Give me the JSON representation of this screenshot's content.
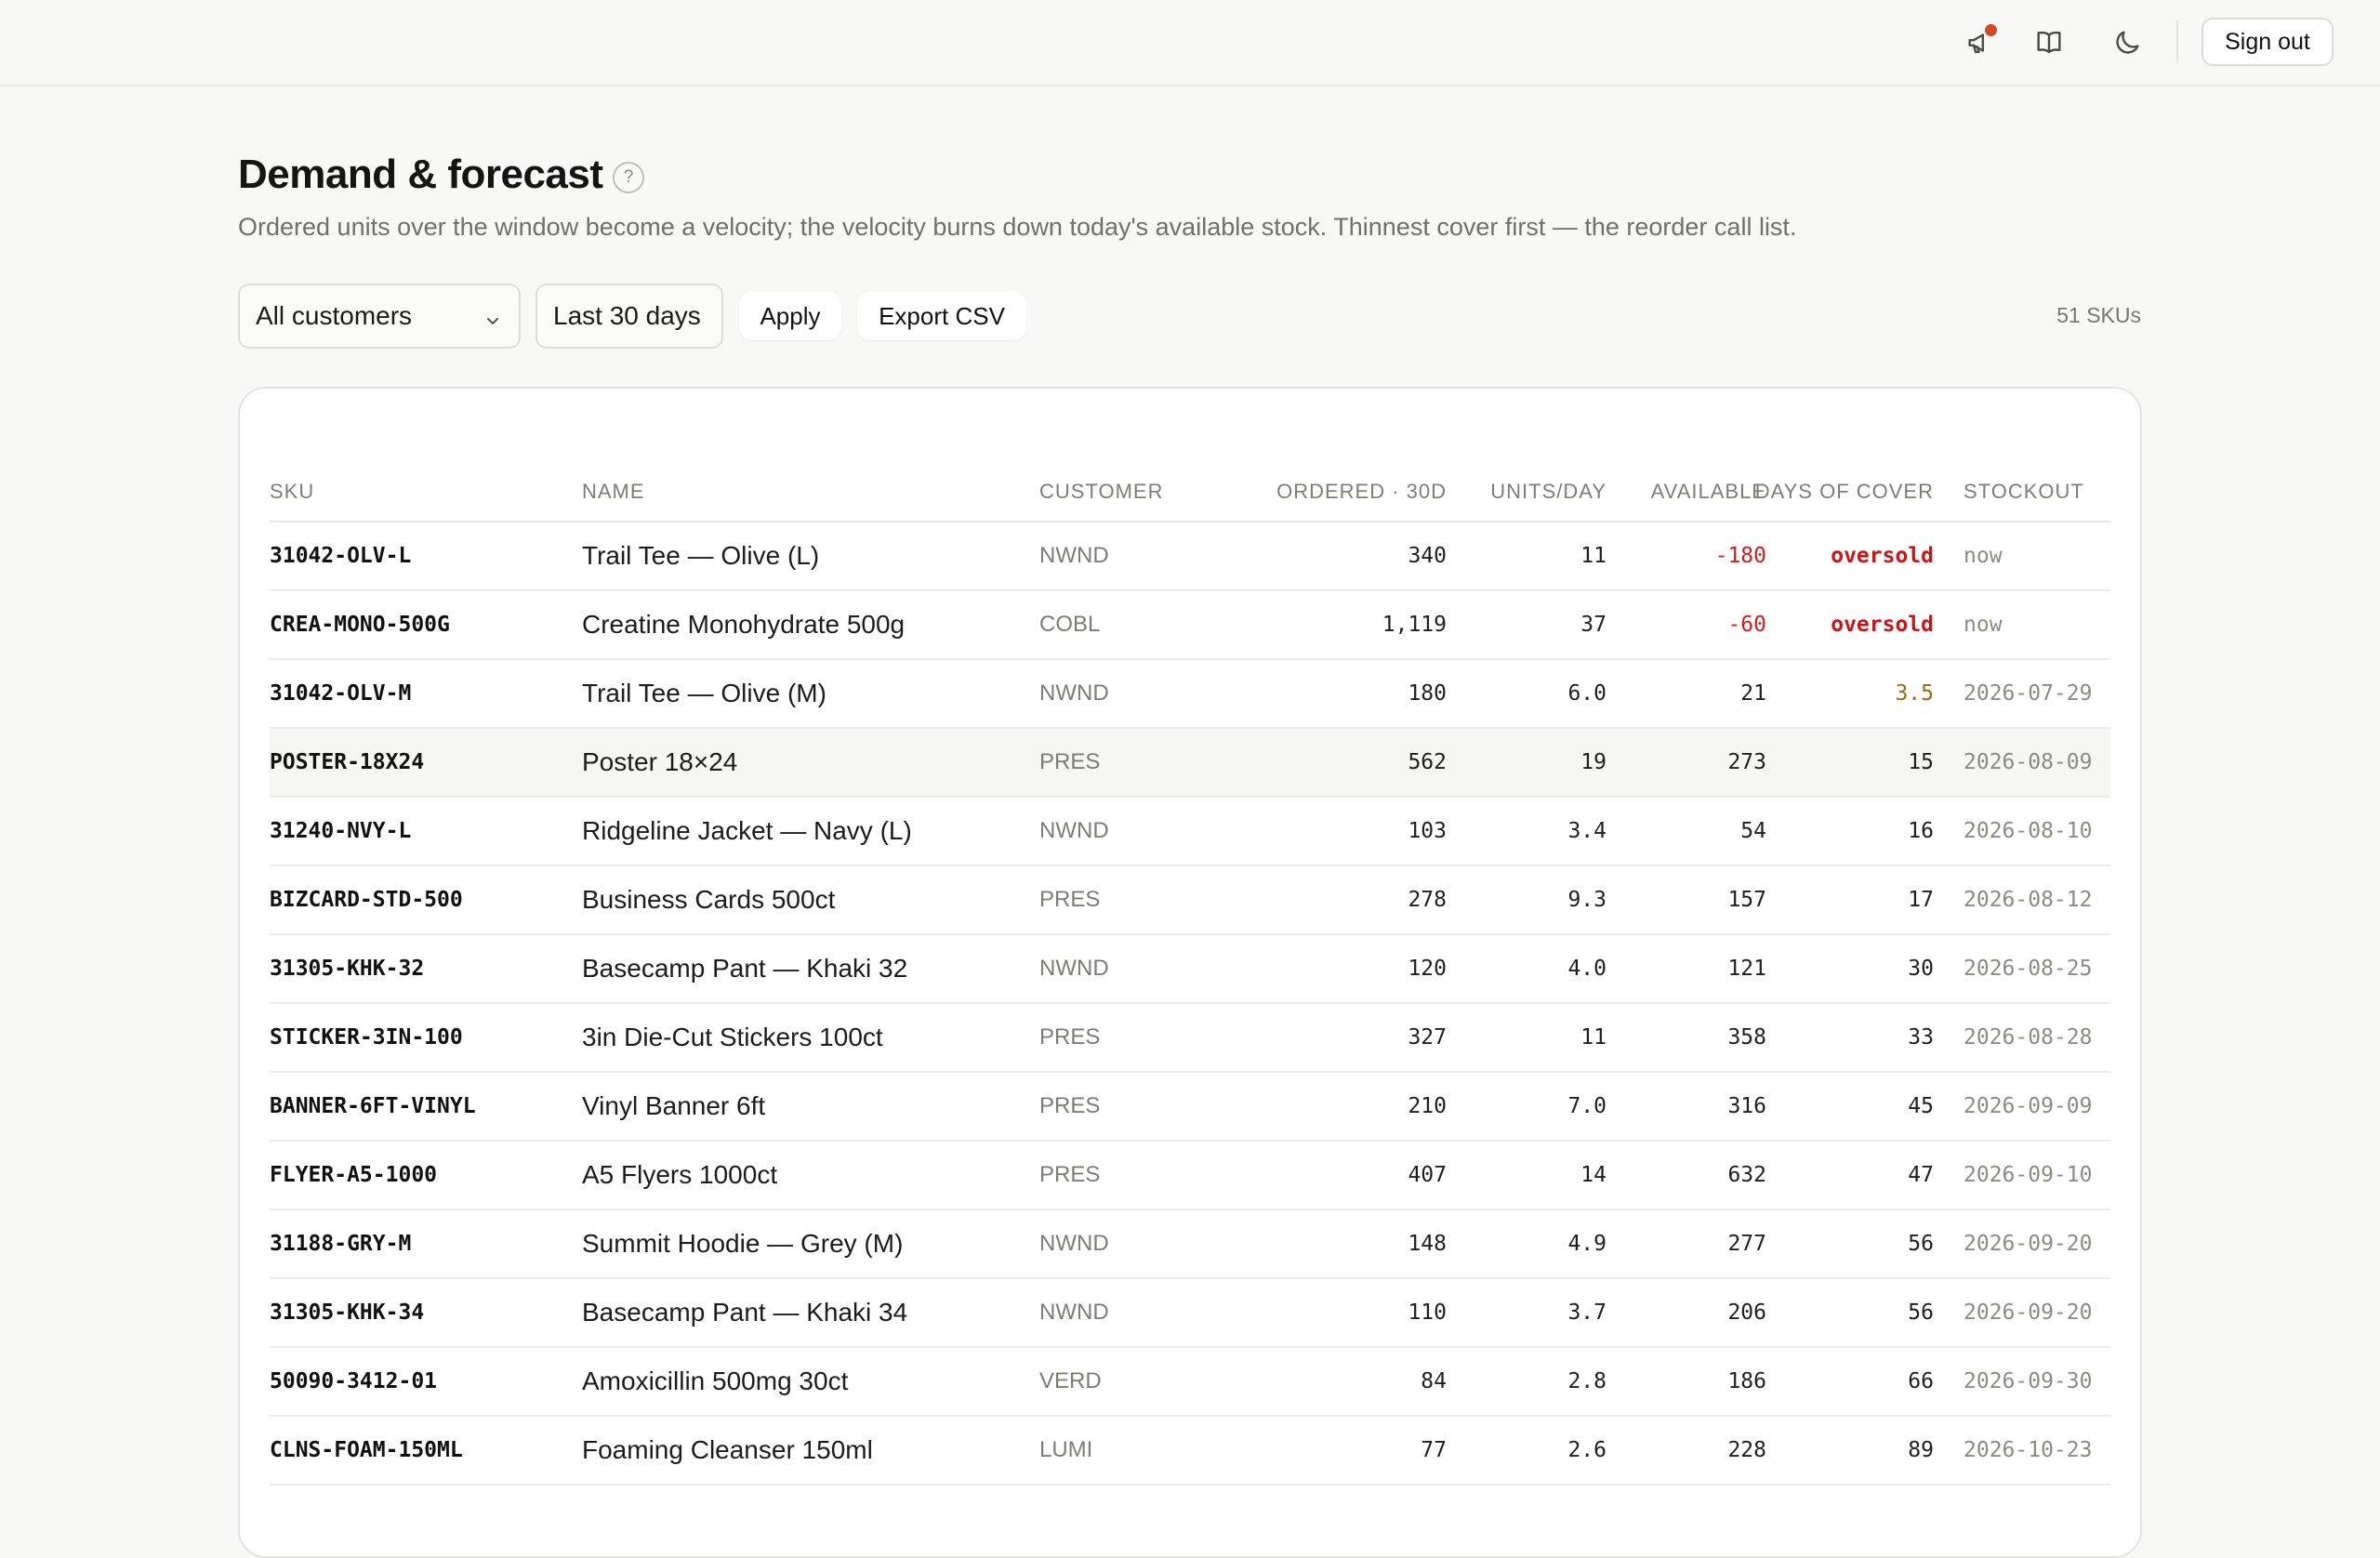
{
  "topbar": {
    "icons": [
      "megaphone-icon",
      "book-icon",
      "moon-icon"
    ],
    "notification_color": "#d04a2a",
    "signout_label": "Sign out"
  },
  "page": {
    "title": "Demand & forecast",
    "help_label": "?",
    "subtitle": "Ordered units over the window become a velocity; the velocity burns down today's available stock. Thinnest cover first — the reorder call list."
  },
  "filters": {
    "customer": "All customers",
    "range": "Last 30 days",
    "apply_label": "Apply",
    "export_label": "Export CSV",
    "sku_count": "51 SKUs"
  },
  "table": {
    "headers": {
      "sku": "SKU",
      "name": "NAME",
      "customer": "CUSTOMER",
      "ordered": "ORDERED · 30D",
      "units_day": "UNITS/DAY",
      "available": "AVAILABLE",
      "cover": "DAYS OF COVER",
      "stockout": "STOCKOUT"
    },
    "rows": [
      {
        "sku": "31042-OLV-L",
        "name": "Trail Tee — Olive (L)",
        "customer": "NWND",
        "ordered": "340",
        "units_day": "11",
        "available": "-180",
        "cover": "oversold",
        "stockout": "now",
        "status": "oversold"
      },
      {
        "sku": "CREA-MONO-500G",
        "name": "Creatine Monohydrate 500g",
        "customer": "COBL",
        "ordered": "1,119",
        "units_day": "37",
        "available": "-60",
        "cover": "oversold",
        "stockout": "now",
        "status": "oversold"
      },
      {
        "sku": "31042-OLV-M",
        "name": "Trail Tee — Olive (M)",
        "customer": "NWND",
        "ordered": "180",
        "units_day": "6.0",
        "available": "21",
        "cover": "3.5",
        "stockout": "2026-07-29",
        "status": "warn"
      },
      {
        "sku": "POSTER-18X24",
        "name": "Poster 18×24",
        "customer": "PRES",
        "ordered": "562",
        "units_day": "19",
        "available": "273",
        "cover": "15",
        "stockout": "2026-08-09",
        "status": "ok",
        "highlight": true
      },
      {
        "sku": "31240-NVY-L",
        "name": "Ridgeline Jacket — Navy (L)",
        "customer": "NWND",
        "ordered": "103",
        "units_day": "3.4",
        "available": "54",
        "cover": "16",
        "stockout": "2026-08-10",
        "status": "ok"
      },
      {
        "sku": "BIZCARD-STD-500",
        "name": "Business Cards 500ct",
        "customer": "PRES",
        "ordered": "278",
        "units_day": "9.3",
        "available": "157",
        "cover": "17",
        "stockout": "2026-08-12",
        "status": "ok"
      },
      {
        "sku": "31305-KHK-32",
        "name": "Basecamp Pant — Khaki 32",
        "customer": "NWND",
        "ordered": "120",
        "units_day": "4.0",
        "available": "121",
        "cover": "30",
        "stockout": "2026-08-25",
        "status": "ok"
      },
      {
        "sku": "STICKER-3IN-100",
        "name": "3in Die-Cut Stickers 100ct",
        "customer": "PRES",
        "ordered": "327",
        "units_day": "11",
        "available": "358",
        "cover": "33",
        "stockout": "2026-08-28",
        "status": "ok"
      },
      {
        "sku": "BANNER-6FT-VINYL",
        "name": "Vinyl Banner 6ft",
        "customer": "PRES",
        "ordered": "210",
        "units_day": "7.0",
        "available": "316",
        "cover": "45",
        "stockout": "2026-09-09",
        "status": "ok"
      },
      {
        "sku": "FLYER-A5-1000",
        "name": "A5 Flyers 1000ct",
        "customer": "PRES",
        "ordered": "407",
        "units_day": "14",
        "available": "632",
        "cover": "47",
        "stockout": "2026-09-10",
        "status": "ok"
      },
      {
        "sku": "31188-GRY-M",
        "name": "Summit Hoodie — Grey (M)",
        "customer": "NWND",
        "ordered": "148",
        "units_day": "4.9",
        "available": "277",
        "cover": "56",
        "stockout": "2026-09-20",
        "status": "ok"
      },
      {
        "sku": "31305-KHK-34",
        "name": "Basecamp Pant — Khaki 34",
        "customer": "NWND",
        "ordered": "110",
        "units_day": "3.7",
        "available": "206",
        "cover": "56",
        "stockout": "2026-09-20",
        "status": "ok"
      },
      {
        "sku": "50090-3412-01",
        "name": "Amoxicillin 500mg 30ct",
        "customer": "VERD",
        "ordered": "84",
        "units_day": "2.8",
        "available": "186",
        "cover": "66",
        "stockout": "2026-09-30",
        "status": "ok"
      },
      {
        "sku": "CLNS-FOAM-150ML",
        "name": "Foaming Cleanser 150ml",
        "customer": "LUMI",
        "ordered": "77",
        "units_day": "2.6",
        "available": "228",
        "cover": "89",
        "stockout": "2026-10-23",
        "status": "ok"
      }
    ]
  },
  "colors": {
    "negative": "#d41c1c",
    "oversold": "#cc1414",
    "warning": "#9a6b12"
  }
}
